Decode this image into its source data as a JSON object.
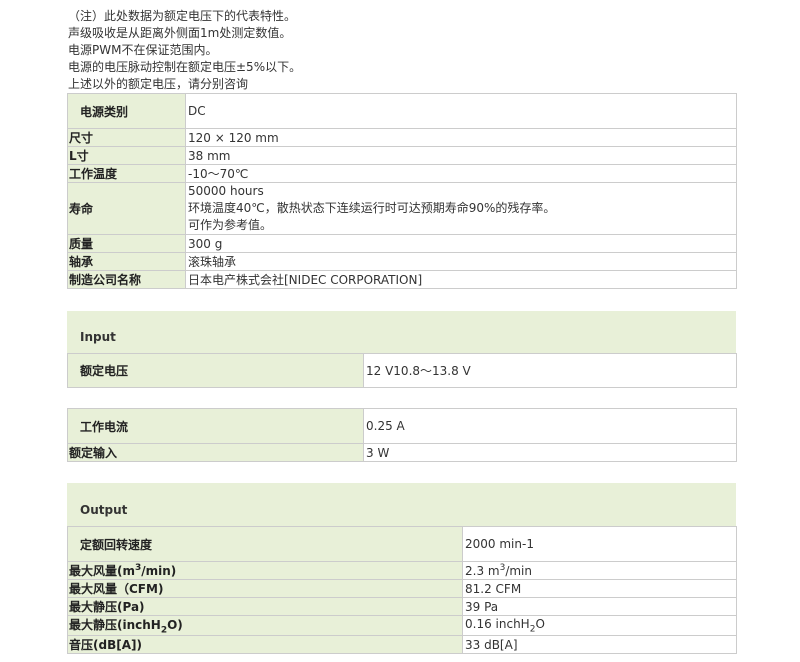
{
  "notes": [
    "（注）此处数据为额定电压下的代表特性。",
    "声级吸收是从距离外侧面1m处测定数值。",
    "电源PWM不在保证范围内。",
    "电源的电压脉动控制在额定电压±5%以下。",
    "上述以外的额定电压，请分别咨询"
  ],
  "specs": [
    {
      "label": "电源类别",
      "value": "DC"
    },
    {
      "label": "尺寸",
      "value": "120 × 120 mm"
    },
    {
      "label": "L寸",
      "value": "38 mm"
    },
    {
      "label": "工作温度",
      "value": "-10～70℃"
    },
    {
      "label": "寿命",
      "lines": [
        "50000 hours",
        "环境温度40℃，散热状态下连续运行时可达预期寿命90%的残存率。",
        "可作为参考值。"
      ]
    },
    {
      "label": "质量",
      "value": "300 g"
    },
    {
      "label": "轴承",
      "value": "滚珠轴承"
    },
    {
      "label": "制造公司名称",
      "value": "日本电产株式会社[NIDEC CORPORATION]"
    }
  ],
  "input": {
    "heading": "Input",
    "rated_voltage": {
      "label": "额定电压",
      "value": "12 V10.8～13.8 V"
    },
    "rows": [
      {
        "label": "工作电流",
        "value": "0.25 A"
      },
      {
        "label": "额定输入",
        "value": "3 W"
      }
    ]
  },
  "output": {
    "heading": "Output",
    "speed": {
      "label": "定额回转速度",
      "value": "2000 min-1"
    },
    "airflow_m3": {
      "label_pre": "最大风量(m",
      "label_sup": "3",
      "label_post": "/min)",
      "value_pre": "2.3 m",
      "value_sup": "3",
      "value_post": "/min"
    },
    "airflow_cfm": {
      "label": "最大风量（CFM)",
      "value": "81.2 CFM"
    },
    "pressure_pa": {
      "label": "最大静压(Pa)",
      "value": "39 Pa"
    },
    "pressure_inch": {
      "label_pre": "最大静压(inchH",
      "label_sub": "2",
      "label_post": "O)",
      "value_pre": "0.16 inchH",
      "value_sub": "2",
      "value_post": "O"
    },
    "noise": {
      "label": "音压(dB[A])",
      "value": "33 dB[A]"
    }
  }
}
